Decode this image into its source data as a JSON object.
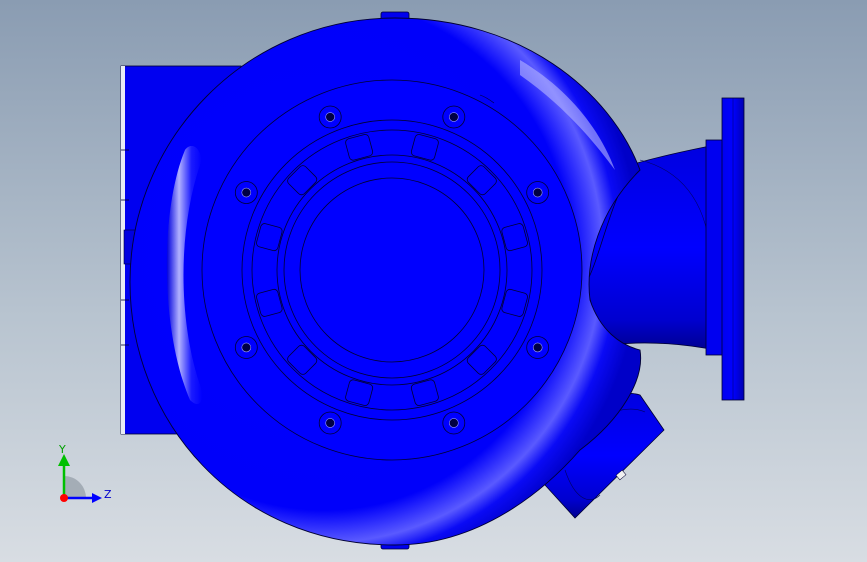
{
  "viewport": {
    "background_top": "#8a9cb2",
    "background_bottom": "#d8dde3"
  },
  "model": {
    "name": "pump-volute-casing",
    "body_color": "#0000ff",
    "edge_color": "#000033",
    "highlight_color": "#c8c8ff"
  },
  "triad": {
    "y_label": "Y",
    "z_label": "Z",
    "y_color": "#00c000",
    "z_color": "#0000ff",
    "origin_color": "#ff0000"
  }
}
